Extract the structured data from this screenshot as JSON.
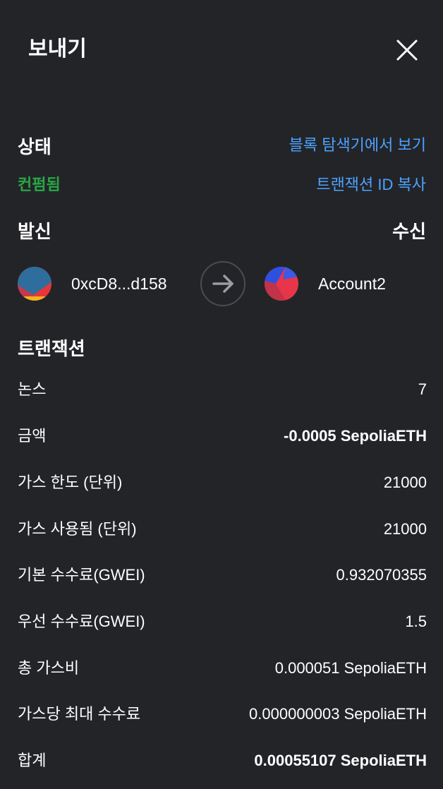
{
  "header": {
    "title": "보내기"
  },
  "status": {
    "label": "상태",
    "value": "컨펌됨",
    "block_explorer_link": "블록 탐색기에서 보기",
    "copy_tx_id_link": "트랜잭션 ID 복사"
  },
  "parties": {
    "from_label": "발신",
    "to_label": "수신",
    "from_address": "0xcD8...d158",
    "to_account": "Account2"
  },
  "transaction": {
    "label": "트랜잭션",
    "rows": [
      {
        "key": "논스",
        "value": "7"
      },
      {
        "key": "금액",
        "value": "-0.0005 SepoliaETH"
      },
      {
        "key": "가스 한도 (단위)",
        "value": "21000"
      },
      {
        "key": "가스 사용됨 (단위)",
        "value": "21000"
      },
      {
        "key": "기본 수수료(GWEI)",
        "value": "0.932070355"
      },
      {
        "key": "우선 수수료(GWEI)",
        "value": "1.5"
      },
      {
        "key": "총 가스비",
        "value": "0.000051 SepoliaETH"
      },
      {
        "key": "가스당 최대 수수료",
        "value": "0.000000003 SepoliaETH"
      },
      {
        "key": "합계",
        "value": "0.00055107 SepoliaETH"
      }
    ]
  },
  "colors": {
    "background": "#232428",
    "link": "#4da2ff",
    "confirmed": "#28a745"
  }
}
